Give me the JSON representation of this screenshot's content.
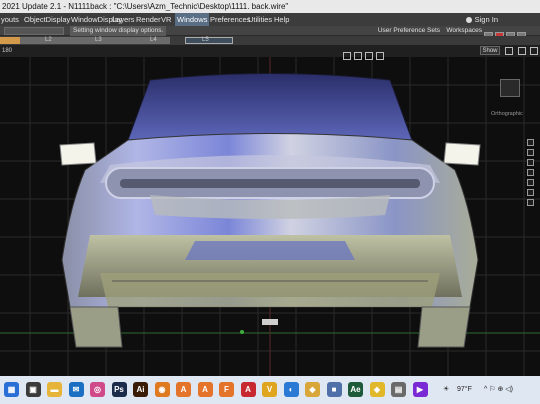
{
  "window": {
    "title": "2021 Update 2.1  - N1111back : \"C:\\Users\\Azm_Technic\\Desktop\\1111. back.wire\""
  },
  "menu": {
    "items": [
      "youts",
      "ObjectDisplay",
      "WindowDisplay",
      "Layers",
      "Render",
      "VR",
      "Windows",
      "Preferences",
      "Utilities",
      "Help"
    ],
    "active": "Windows",
    "sign_in": "Sign In"
  },
  "status": {
    "help_text": "Setting window display options.",
    "user_pref_sets": "User Preference Sets",
    "workspaces": "Workspaces"
  },
  "layers": {
    "label_a": "L2",
    "label_b": "L3",
    "label_c": "L4",
    "label_d": "L5"
  },
  "viewport": {
    "zoom": "180",
    "show_button": "Show",
    "view_label": "Orthographic"
  },
  "taskbar": {
    "icons": [
      {
        "name": "start-menu-icon",
        "glyph": "▦",
        "color": "#2a6fd6"
      },
      {
        "name": "store-icon",
        "glyph": "▣",
        "color": "#3a3a3a"
      },
      {
        "name": "file-explorer-icon",
        "glyph": "▬",
        "color": "#e7b43a"
      },
      {
        "name": "mail-icon",
        "glyph": "✉",
        "color": "#1a6fc2"
      },
      {
        "name": "camera-icon",
        "glyph": "◎",
        "color": "#d04a8a"
      },
      {
        "name": "photoshop-icon",
        "glyph": "Ps",
        "color": "#1b2c4a"
      },
      {
        "name": "illustrator-icon",
        "glyph": "Ai",
        "color": "#3a1c06"
      },
      {
        "name": "blender-icon",
        "glyph": "◉",
        "color": "#e07a20"
      },
      {
        "name": "alias-icon-1",
        "glyph": "A",
        "color": "#e3742a"
      },
      {
        "name": "alias-icon-2",
        "glyph": "A",
        "color": "#e3742a"
      },
      {
        "name": "app-f-icon",
        "glyph": "F",
        "color": "#e3742a"
      },
      {
        "name": "app-a-red-icon",
        "glyph": "A",
        "color": "#c8282f"
      },
      {
        "name": "app-v-icon",
        "glyph": "V",
        "color": "#e0a51f"
      },
      {
        "name": "browser-icon",
        "glyph": "◐",
        "color": "#2a79d4"
      },
      {
        "name": "app-gold-icon",
        "glyph": "◆",
        "color": "#d9a63a"
      },
      {
        "name": "app-blue-icon",
        "glyph": "■",
        "color": "#4f6fa8"
      },
      {
        "name": "app-green-icon",
        "glyph": "Ae",
        "color": "#1d5a3a"
      },
      {
        "name": "app-yellow-icon",
        "glyph": "◆",
        "color": "#e0b82a"
      },
      {
        "name": "app-grey-icon",
        "glyph": "▤",
        "color": "#6a6a6a"
      },
      {
        "name": "app-purple-icon",
        "glyph": "▶",
        "color": "#7a2ad4"
      }
    ],
    "weather": "97°F",
    "tray_icons": "^ ⚐ ⊕ ◁)"
  }
}
